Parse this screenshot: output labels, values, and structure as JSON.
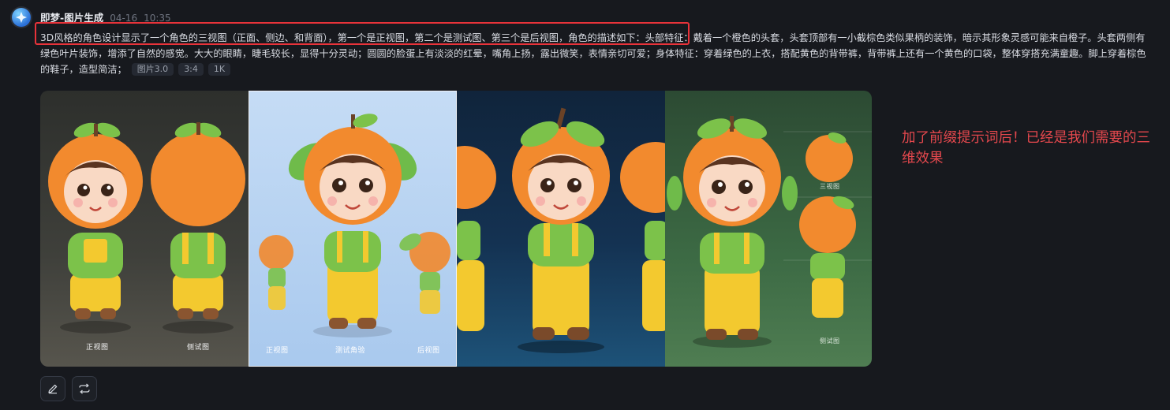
{
  "message": {
    "sender": "即梦-图片生成",
    "date": "04-16",
    "time": "10:35",
    "prompt_main": "3D风格的角色设计显示了一个角色的三视图（正面、侧边、和背面），第一个是正视图，第二个是测试图、第三个是后视图，角色的描述如下：头部特征：戴着一个橙色的头套，头套顶部有一小截棕色类似果柄的装饰，暗示其形象灵感可能来自橙子。头套两侧有绿色叶片装饰，增添了自然的感觉。大大的眼睛，睫毛较长，显得十分灵动；圆圆的脸蛋上有淡淡的红晕，嘴角上扬，露出微笑，表情亲切可爱；身体特征：穿着绿色的上衣，搭配黄色的背带裤，背带裤上还有一个黄色的口袋，整体穿搭充满童趣。脚上穿着棕色的鞋子，造型简洁；",
    "tags": [
      "图片3.0",
      "3:4",
      "1K"
    ]
  },
  "images": [
    {
      "labels": [
        "正视图",
        "侧试图"
      ]
    },
    {
      "labels": [
        "正视图",
        "测试角验",
        "后视图"
      ]
    },
    {
      "labels": []
    },
    {
      "labels": [
        "三视图",
        "侧试图"
      ]
    }
  ],
  "annotation": "加了前缀提示词后！已经是我们需要的三维效果",
  "colors": {
    "highlight": "#e8333a",
    "annotation": "#e5484d",
    "orange": "#f28a2e",
    "green": "#7cc24a",
    "yellow": "#f3c92f"
  },
  "actions": [
    {
      "icon": "edit-icon"
    },
    {
      "icon": "regenerate-icon"
    }
  ]
}
